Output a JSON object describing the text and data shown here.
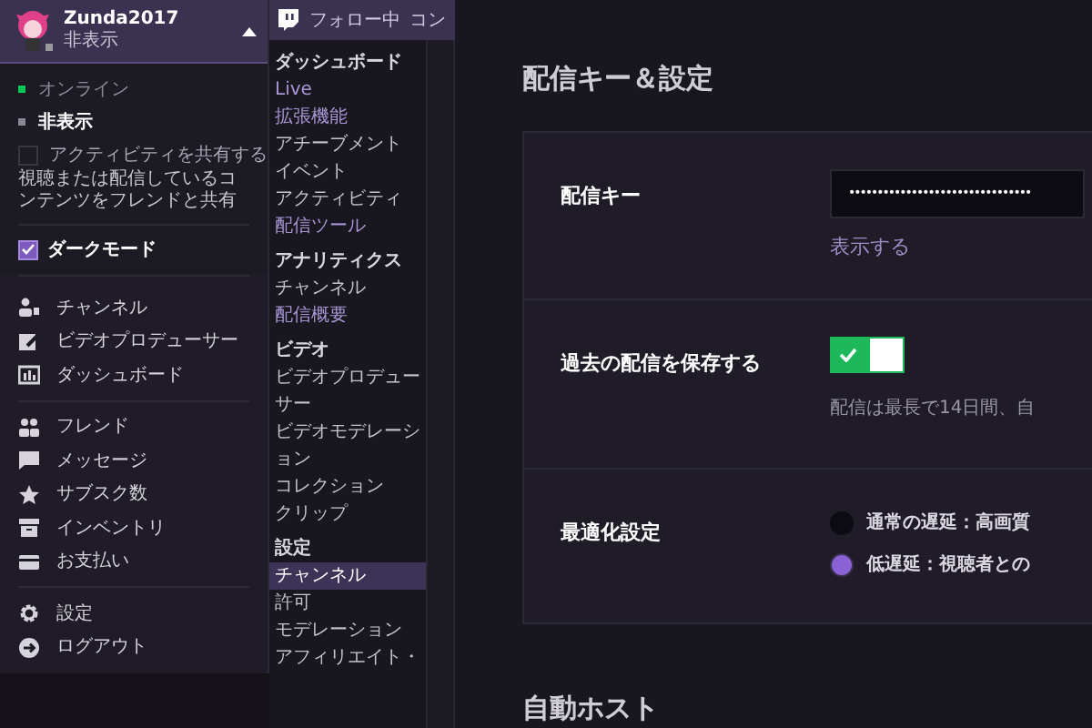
{
  "account_menu": {
    "username": "Zunda2017",
    "status": "非表示",
    "expanded": true,
    "statuses": [
      {
        "label": "オンライン",
        "color": "#00c853",
        "selected": false
      },
      {
        "label": "非表示",
        "color": "#8a8794",
        "selected": true
      }
    ],
    "share_activity": {
      "label": "アクティビティを共有する",
      "checked": false,
      "description": "視聴または配信しているコンテンツをフレンドと共有"
    },
    "dark_mode": {
      "label": "ダークモード",
      "checked": true
    },
    "groups": [
      {
        "items": [
          {
            "label": "チャンネル"
          },
          {
            "label": "ビデオプロデューサー"
          },
          {
            "label": "ダッシュボード"
          }
        ]
      },
      {
        "items": [
          {
            "label": "フレンド"
          },
          {
            "label": "メッセージ"
          },
          {
            "label": "サブスク数"
          },
          {
            "label": "インベントリ"
          },
          {
            "label": "お支払い"
          }
        ]
      },
      {
        "items": [
          {
            "label": "設定"
          },
          {
            "label": "ログアウト"
          }
        ]
      }
    ]
  },
  "top_nav": {
    "links": [
      {
        "label": "フォロー中"
      },
      {
        "label": "コン"
      }
    ]
  },
  "sidebar": {
    "sections": [
      {
        "heading": "ダッシュボード",
        "items": [
          {
            "label": "Live",
            "accent": true,
            "selected": false
          },
          {
            "label": "拡張機能",
            "accent": true,
            "selected": false
          },
          {
            "label": "アチーブメント",
            "accent": false,
            "selected": false
          },
          {
            "label": "イベント",
            "accent": false,
            "selected": false
          },
          {
            "label": "アクティビティ",
            "accent": false,
            "selected": false
          },
          {
            "label": "配信ツール",
            "accent": true,
            "selected": false
          }
        ]
      },
      {
        "heading": "アナリティクス",
        "items": [
          {
            "label": "チャンネル",
            "accent": false,
            "selected": false
          },
          {
            "label": "配信概要",
            "accent": true,
            "selected": false
          }
        ]
      },
      {
        "heading": "ビデオ",
        "items": [
          {
            "label": "ビデオプロデューサー",
            "accent": false,
            "selected": false
          },
          {
            "label": "ビデオモデレーション",
            "accent": false,
            "selected": false
          },
          {
            "label": "コレクション",
            "accent": false,
            "selected": false
          },
          {
            "label": "クリップ",
            "accent": false,
            "selected": false
          }
        ]
      },
      {
        "heading": "設定",
        "items": [
          {
            "label": "チャンネル",
            "accent": false,
            "selected": true
          },
          {
            "label": "許可",
            "accent": false,
            "selected": false
          },
          {
            "label": "モデレーション",
            "accent": false,
            "selected": false
          },
          {
            "label": "アフィリエイト・",
            "accent": false,
            "selected": false
          }
        ]
      }
    ]
  },
  "main": {
    "title": "配信キー＆設定",
    "settings": [
      {
        "kind": "key",
        "label": "配信キー",
        "value": "••••••••••••••••••••••••••••••••",
        "action": "表示する"
      },
      {
        "kind": "toggle",
        "label": "過去の配信を保存する",
        "on": true,
        "hint": "配信は最長で14日間、自"
      },
      {
        "kind": "radio",
        "label": "最適化設定",
        "options": [
          {
            "label": "通常の遅延：高画質",
            "selected": false
          },
          {
            "label": "低遅延：視聴者との",
            "selected": true
          }
        ]
      }
    ],
    "next_section_title": "自動ホスト"
  }
}
